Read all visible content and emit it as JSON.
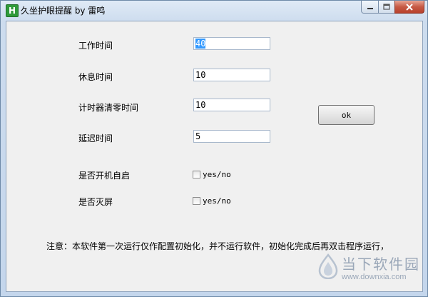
{
  "window": {
    "title": "久坐护眼提醒 by 雷鸣",
    "icon_letter": "H"
  },
  "form": {
    "work_time": {
      "label": "工作时间",
      "value": "40"
    },
    "rest_time": {
      "label": "休息时间",
      "value": "10"
    },
    "reset_time": {
      "label": "计时器清零时间",
      "value": "10"
    },
    "delay_time": {
      "label": "延迟时间",
      "value": "5"
    },
    "autostart": {
      "label": "是否开机自启",
      "option": "yes/no",
      "checked": false
    },
    "screen_off": {
      "label": "是否灭屏",
      "option": "yes/no",
      "checked": false
    }
  },
  "ok_button": {
    "label": "ok"
  },
  "note": "注意：本软件第一次运行仅作配置初始化，并不运行软件，初始化完成后再双击程序运行，",
  "watermark": {
    "text": "当下软件园",
    "url": "www.downxia.com"
  },
  "colors": {
    "selection": "#3399ff",
    "close_button": "#c75a45"
  }
}
